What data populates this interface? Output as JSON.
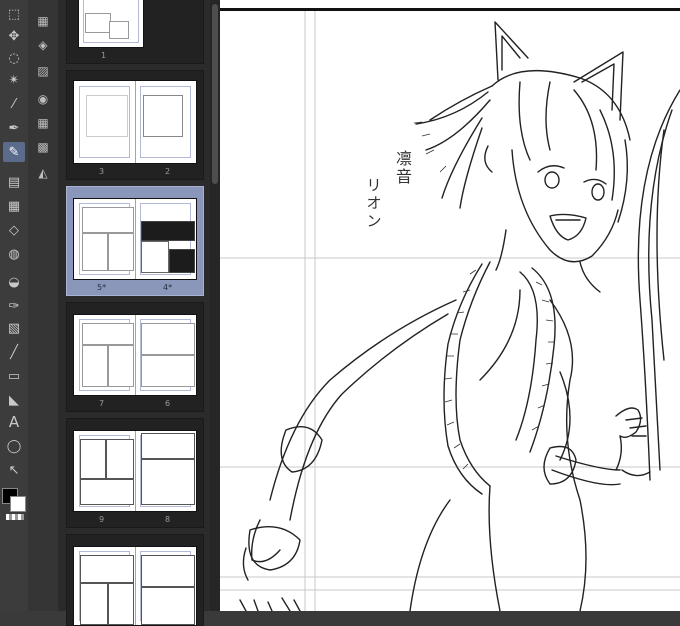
{
  "app": {
    "page_labels": [
      "1",
      "3",
      "2",
      "5*",
      "4*",
      "7",
      "6",
      "9",
      "8"
    ],
    "selected_spread": "5*-4*"
  },
  "canvas": {
    "vertical_text_1": [
      "凛",
      "音"
    ],
    "vertical_text_2": [
      "リ",
      "オ",
      "ン"
    ]
  },
  "toolbar": {
    "icons": [
      "select-icon",
      "move-icon",
      "lasso-icon",
      "magic-wand-icon",
      "eyedropper-icon",
      "pen-icon",
      "pencil-icon",
      "brush-icon",
      "airbrush-icon",
      "eraser-icon",
      "blend-icon",
      "fill-icon",
      "figure-pen-icon",
      "gradient-icon",
      "line-icon",
      "frame-icon",
      "ruler-icon",
      "text-icon",
      "balloon-icon",
      "correct-line-icon"
    ],
    "active": "pencil-icon"
  },
  "colors": {
    "main": "#000000",
    "sub": "#ffffff",
    "accent": "#5b6b8c",
    "selected_card": "#8b96bb"
  }
}
